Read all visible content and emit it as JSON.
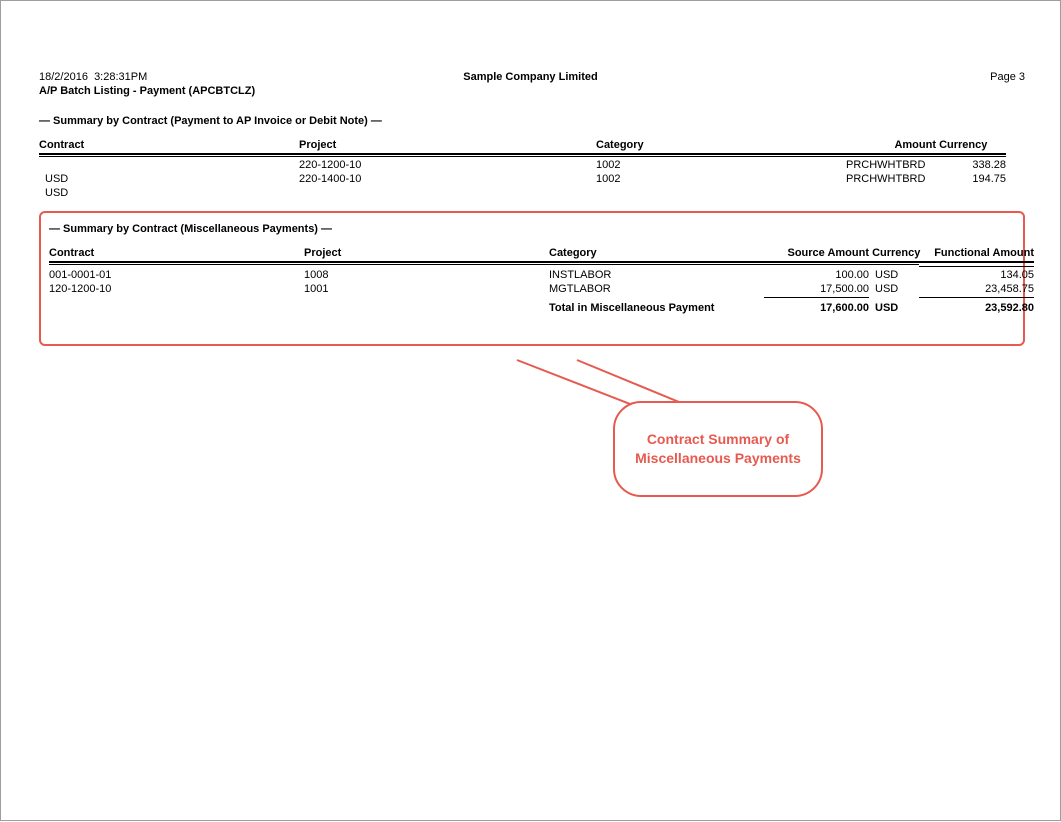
{
  "header": {
    "date": "18/2/2016",
    "time": "3:28:31PM",
    "company": "Sample Company Limited",
    "page_label": "Page 3",
    "subtitle": "A/P Batch Listing - Payment (APCBTCLZ)"
  },
  "section1": {
    "title": "— Summary by Contract (Payment to AP Invoice or Debit Note) —",
    "cols": {
      "contract": "Contract",
      "project": "Project",
      "category": "Category",
      "amount": "Amount",
      "currency": "Currency"
    },
    "rows": [
      {
        "contract": "220-1200-10",
        "project": "1002",
        "category": "PRCHWHTBRD",
        "amount": "338.28",
        "currency": "USD"
      },
      {
        "contract": "220-1400-10",
        "project": "1002",
        "category": "PRCHWHTBRD",
        "amount": "194.75",
        "currency": "USD"
      }
    ]
  },
  "section2": {
    "title": "— Summary by Contract (Miscellaneous Payments) —",
    "cols": {
      "contract": "Contract",
      "project": "Project",
      "category": "Category",
      "src_amount": "Source Amount",
      "currency": "Currency",
      "func_amount": "Functional Amount"
    },
    "rows": [
      {
        "contract": "001-0001-01",
        "project": "1008",
        "category": "INSTLABOR",
        "src_amount": "100.00",
        "currency": "USD",
        "func_amount": "134.05"
      },
      {
        "contract": "120-1200-10",
        "project": "1001",
        "category": "MGTLABOR",
        "src_amount": "17,500.00",
        "currency": "USD",
        "func_amount": "23,458.75"
      }
    ],
    "total": {
      "label": "Total in Miscellaneous Payment",
      "src_amount": "17,600.00",
      "currency": "USD",
      "func_amount": "23,592.80"
    }
  },
  "callout": {
    "text": "Contract Summary of Miscellaneous Payments"
  }
}
